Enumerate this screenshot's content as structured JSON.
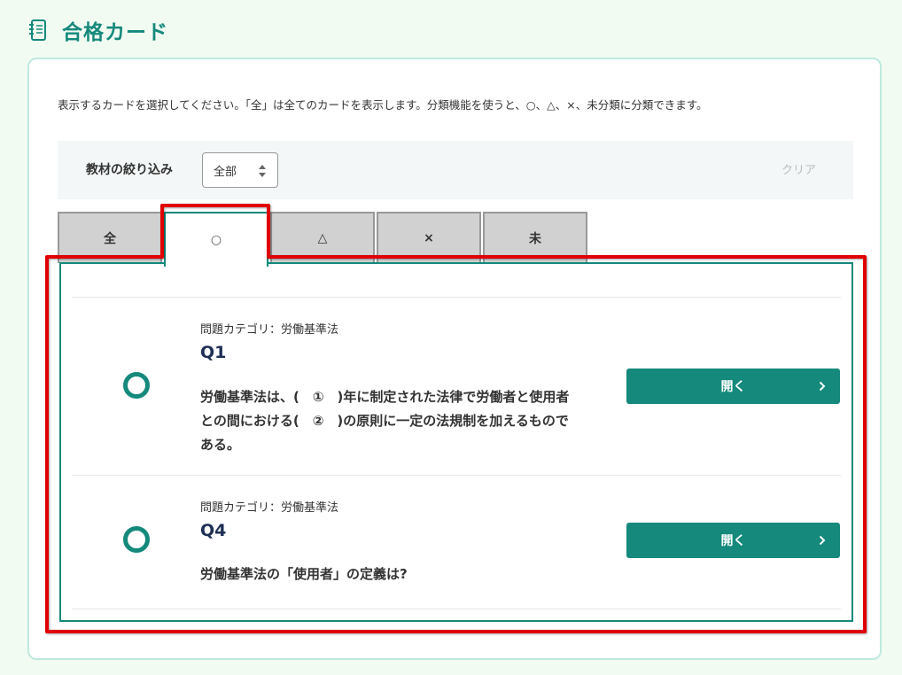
{
  "page": {
    "title": "合格カード"
  },
  "panel": {
    "description": "表示するカードを選択してください。「全」は全てのカードを表示します。分類機能を使うと、○、△、×、未分類に分類できます。",
    "filter": {
      "label": "教材の絞り込み",
      "selected": "全部",
      "clear_label": "クリア"
    },
    "tabs": [
      {
        "label": "全"
      },
      {
        "label": "○"
      },
      {
        "label": "△"
      },
      {
        "label": "×"
      },
      {
        "label": "未"
      }
    ],
    "active_tab": "○",
    "cards": [
      {
        "category": "問題カテゴリ：労働基準法",
        "qnum": "Q1",
        "text": "労働基準法は、(　①　)年に制定された法律で労働者と使用者との間における(　②　)の原則に一定の法規制を加えるものである。",
        "button_label": "開く"
      },
      {
        "category": "問題カテゴリ：労働基準法",
        "qnum": "Q4",
        "text": "労働基準法の「使用者」の定義は?",
        "button_label": "開く"
      }
    ]
  },
  "colors": {
    "accent": "#14897c",
    "highlight": "#e00000",
    "background": "#f1fbf2"
  }
}
